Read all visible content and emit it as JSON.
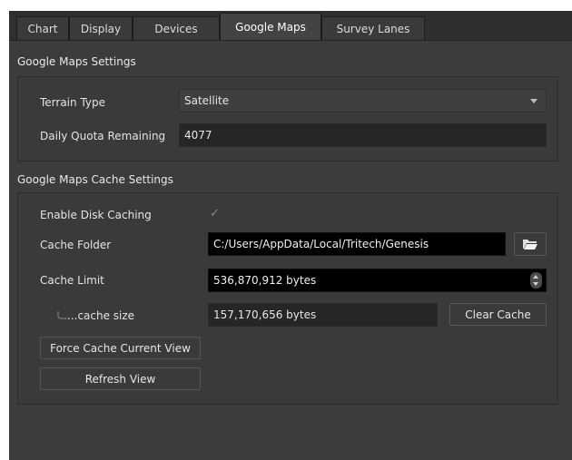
{
  "tabs": [
    {
      "label": "Chart"
    },
    {
      "label": "Display"
    },
    {
      "label": "Devices"
    },
    {
      "label": "Google Maps",
      "active": true
    },
    {
      "label": "Survey Lanes"
    }
  ],
  "maps_settings": {
    "title": "Google Maps Settings",
    "terrain_label": "Terrain Type",
    "terrain_value": "Satellite",
    "quota_label": "Daily Quota Remaining",
    "quota_value": "4077"
  },
  "cache_settings": {
    "title": "Google Maps Cache Settings",
    "enable_label": "Enable Disk Caching",
    "enable_checked": true,
    "folder_label": "Cache Folder",
    "folder_value": "C:/Users/AppData/Local/Tritech/Genesis",
    "limit_label": "Cache Limit",
    "limit_value": "536,870,912 bytes",
    "size_label": "...cache size",
    "size_value": "157,170,656 bytes",
    "clear_button": "Clear Cache",
    "force_button": "Force Cache Current View",
    "refresh_button": "Refresh View"
  },
  "icons": {
    "folder": "folder-open-icon",
    "combo_arrow": "chevron-down-icon",
    "spin": "spinbox-arrows-icon",
    "check": "checkmark-icon",
    "tree_branch": "tree-branch-icon"
  }
}
